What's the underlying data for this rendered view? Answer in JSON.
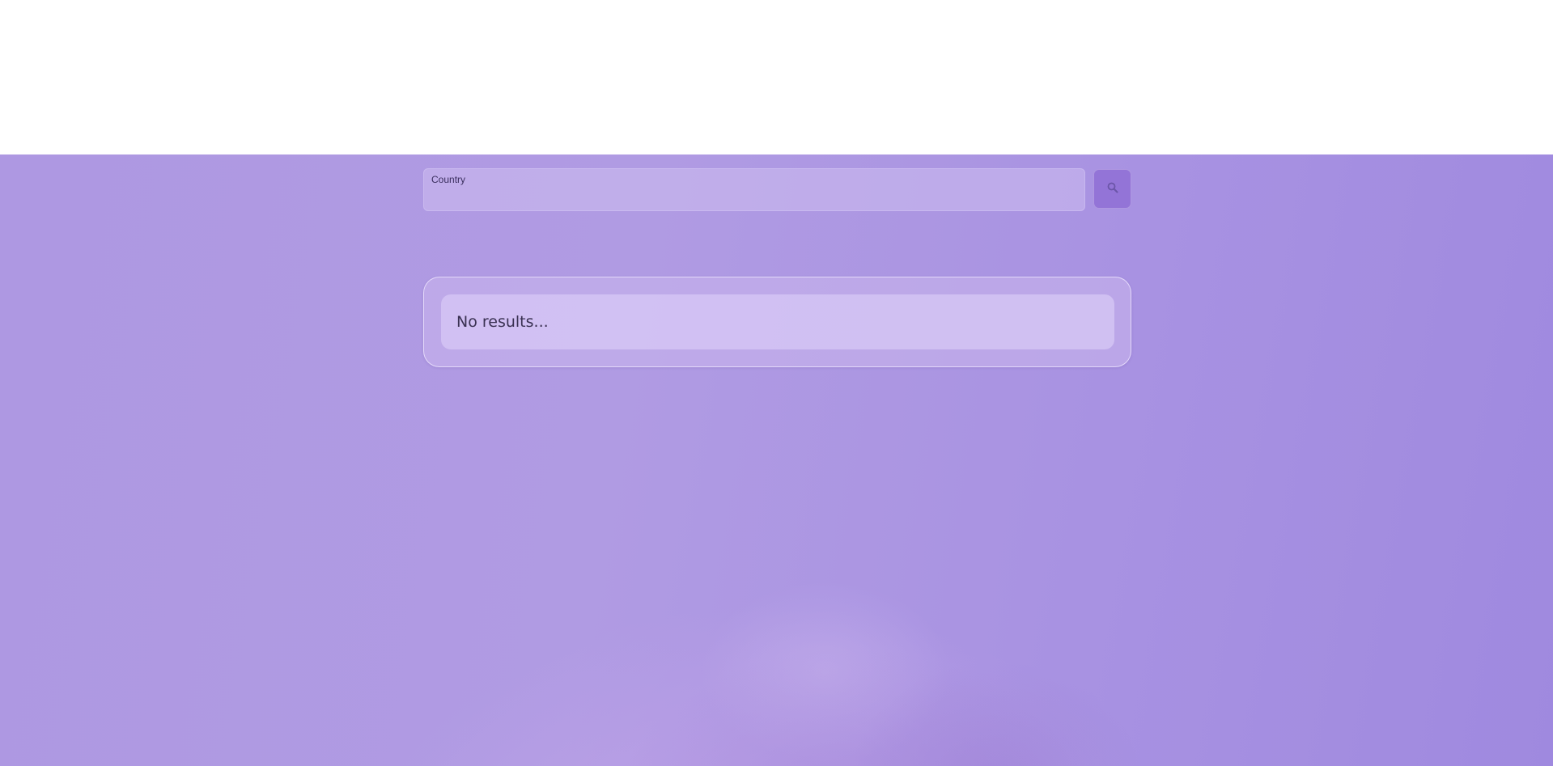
{
  "search": {
    "label": "Country",
    "value": "",
    "placeholder": "",
    "button_icon": "search-icon"
  },
  "results": {
    "message": "No results..."
  },
  "colors": {
    "background": "#ad97e2",
    "button": "#9374d7",
    "text": "#3a3152"
  }
}
